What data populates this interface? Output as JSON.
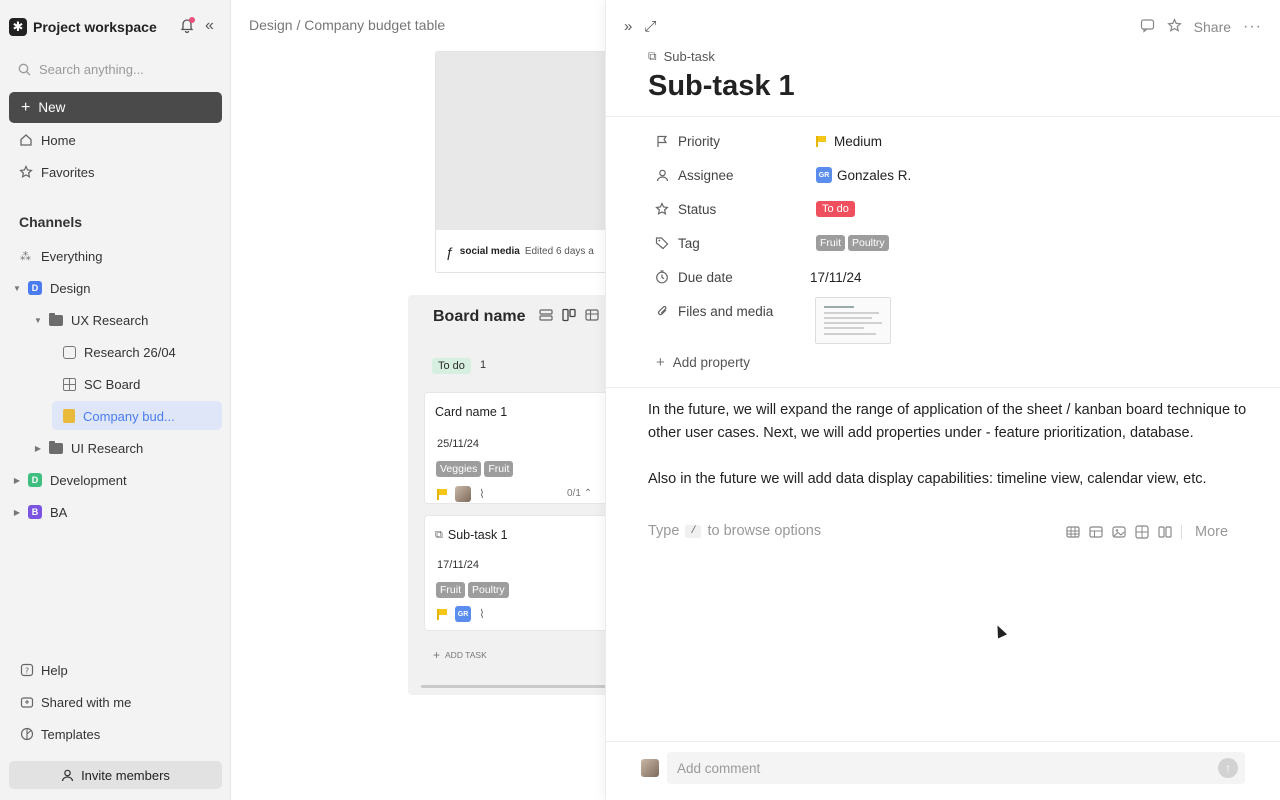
{
  "sidebar": {
    "workspace_name": "Project workspace",
    "search_placeholder": "Search anything...",
    "new_label": "New",
    "nav": {
      "home": "Home",
      "favorites": "Favorites"
    },
    "channels_title": "Channels",
    "tree": {
      "everything": "Everything",
      "design": {
        "badge": "D",
        "label": "Design",
        "color": "#4a7cf0"
      },
      "ux_research": "UX Research",
      "research": "Research 26/04",
      "sc_board": "SC Board",
      "company_budget": "Company bud...",
      "ui_research": "UI Research",
      "development": {
        "badge": "D",
        "label": "Development",
        "color": "#3fbf7f"
      },
      "ba": {
        "badge": "B",
        "label": "BA",
        "color": "#7b55e0"
      }
    },
    "bottom": {
      "help": "Help",
      "shared": "Shared with me",
      "templates": "Templates"
    },
    "invite_label": "Invite members"
  },
  "main": {
    "breadcrumb": "Design / Company budget table",
    "image_card": {
      "name": "social media",
      "edited": "Edited 6 days a"
    },
    "board": {
      "title": "Board name",
      "status": "To do",
      "count": "1",
      "cards": [
        {
          "title": "Card name 1",
          "date": "25/11/24",
          "tags": [
            "Veggies",
            "Fruit"
          ],
          "progress": "0/1"
        },
        {
          "title": "Sub-task 1",
          "date": "17/11/24",
          "tags": [
            "Fruit",
            "Poultry"
          ],
          "avatar": "GR"
        }
      ],
      "add_task": "ADD TASK"
    }
  },
  "panel": {
    "share_label": "Share",
    "crumb": "Sub-task",
    "title": "Sub-task 1",
    "props": {
      "priority": {
        "label": "Priority",
        "value": "Medium"
      },
      "assignee": {
        "label": "Assignee",
        "value": "Gonzales R.",
        "initials": "GR"
      },
      "status": {
        "label": "Status",
        "value": "To do",
        "color": "#f04f5e"
      },
      "tag": {
        "label": "Tag",
        "values": [
          "Fruit",
          "Poultry"
        ]
      },
      "due": {
        "label": "Due date",
        "value": "17/11/24"
      },
      "files": {
        "label": "Files and media"
      }
    },
    "add_property": "Add property",
    "body": [
      "In the future, we will expand the range of application of the sheet / kanban board technique to other user cases. Next, we will add properties under - feature prioritization, database.",
      "Also in the future we will add data display capabilities: timeline view, calendar view, etc."
    ],
    "hint": {
      "type": "Type",
      "key": "/",
      "rest": "to browse options"
    },
    "more_label": "More",
    "comment_placeholder": "Add comment"
  }
}
